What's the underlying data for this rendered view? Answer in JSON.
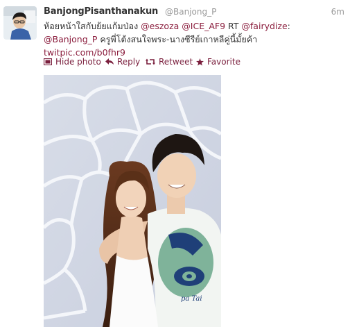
{
  "tweet": {
    "display_name": "BanjongPisanthanakun",
    "handle": "@Banjong_P",
    "timestamp": "6m",
    "text_parts": [
      {
        "text": "ห้อยหน้าใสกับย้ยแก้มป่อง ",
        "type": "plain"
      },
      {
        "text": "@eszoza",
        "type": "mention"
      },
      {
        "text": " ",
        "type": "plain"
      },
      {
        "text": "@ICE_AF9",
        "type": "mention"
      },
      {
        "text": " RT ",
        "type": "plain"
      },
      {
        "text": "@fairydize",
        "type": "mention"
      },
      {
        "text": ":",
        "type": "plain"
      },
      {
        "text": "@Banjong_P",
        "type": "mention"
      },
      {
        "text": " ครูพี่โต้งสนใจพระ-นางซีรีย์เกาหลีคู่นี้มั้ยค้า",
        "type": "plain"
      },
      {
        "text": "twitpic.com/b0fhr9",
        "type": "link"
      }
    ]
  },
  "actions": {
    "hide_photo": "Hide photo",
    "reply": "Reply",
    "retweet": "Retweet",
    "favorite": "Favorite"
  },
  "photo": {
    "overlay_text": "pa Tai"
  },
  "colors": {
    "link": "#8a1c3c",
    "text": "#333333",
    "meta": "#999999"
  }
}
